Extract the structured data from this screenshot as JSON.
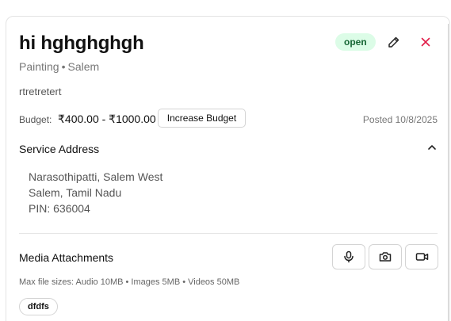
{
  "job": {
    "title": "hi hghghghgh",
    "category": "Painting",
    "separator": "•",
    "location": "Salem",
    "description": "rtretretert",
    "status": "open"
  },
  "budget": {
    "label": "Budget:",
    "range": "₹400.00 - ₹1000.00",
    "increase_label": "Increase Budget"
  },
  "posted": "Posted 10/8/2025",
  "service_address": {
    "title": "Service Address",
    "line1": "Narasothipatti, Salem West",
    "line2": "Salem, Tamil Nadu",
    "line3": "PIN: 636004"
  },
  "media": {
    "title": "Media Attachments",
    "file_sizes": "Max file sizes: Audio 10MB • Images 5MB • Videos 50MB",
    "attachments": [
      "dfdfs"
    ]
  },
  "icons": {
    "edit": "pencil-icon",
    "close": "close-icon",
    "collapse": "chevron-up-icon",
    "mic": "microphone-icon",
    "camera": "camera-icon",
    "video": "video-icon"
  },
  "colors": {
    "status_bg": "#dcfce7",
    "status_text": "#166534",
    "close": "#e11d48"
  }
}
